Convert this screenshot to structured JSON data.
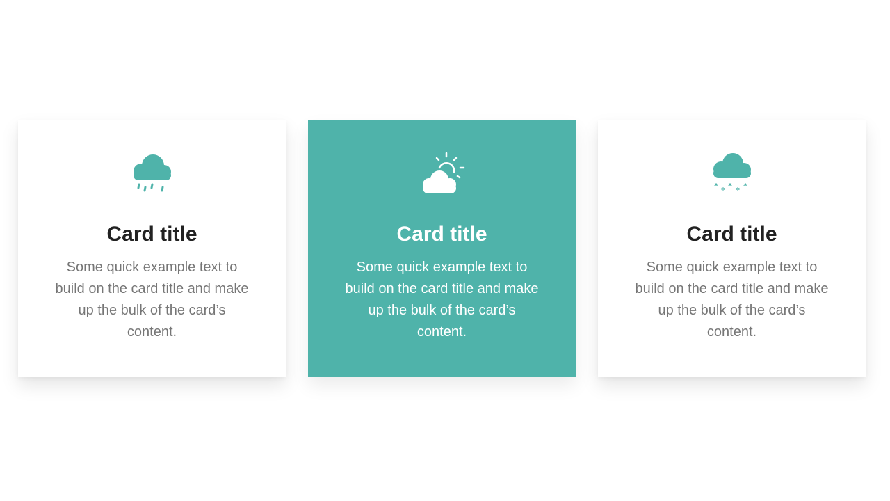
{
  "theme": {
    "accent": "#4fb3aa"
  },
  "cards": [
    {
      "icon": "rain-cloud-icon",
      "title": "Card title",
      "text": "Some quick example text to build on the card title and make up the bulk of the card’s content.",
      "highlighted": false
    },
    {
      "icon": "partly-sunny-icon",
      "title": "Card title",
      "text": "Some quick example text to build on the card title and make up the bulk of the card’s content.",
      "highlighted": true
    },
    {
      "icon": "snow-cloud-icon",
      "title": "Card title",
      "text": "Some quick example text to build on the card title and make up the bulk of the card’s content.",
      "highlighted": false
    }
  ]
}
